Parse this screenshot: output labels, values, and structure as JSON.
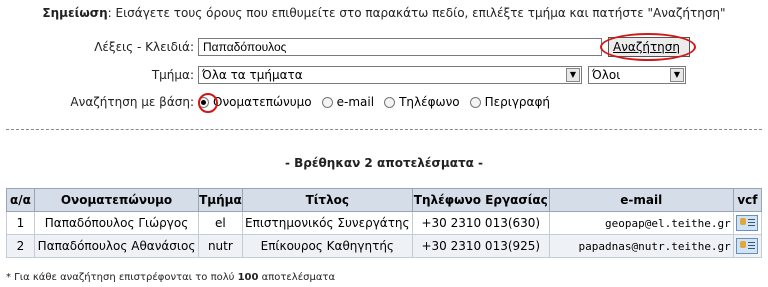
{
  "note": {
    "bold": "Σημείωση",
    "text": ": Εισάγετε τους όρους που επιθυμείτε στο παρακάτω πεδίο, επιλέξτε τμήμα και πατήστε \"Αναζήτηση\""
  },
  "form": {
    "keywords_label": "Λέξεις - Κλειδιά:",
    "keywords_value": "Παπαδόπουλος",
    "search_button": "Αναζήτηση",
    "department_label": "Τμήμα:",
    "department_value": "Όλα τα τμήματα",
    "role_value": "Όλοι",
    "searchby_label": "Αναζήτηση με βάση:",
    "options": [
      "Ονοματεπώνυμο",
      "e-mail",
      "Τηλέφωνο",
      "Περιγραφή"
    ],
    "selected_option": "Ονοματεπώνυμο"
  },
  "results": {
    "summary": "- Βρέθηκαν 2 αποτελέσματα -",
    "headers": [
      "α/α",
      "Ονοματεπώνυμο",
      "Τμήμα",
      "Τίτλος",
      "Τηλέφωνο Εργασίας",
      "e-mail",
      "vcf"
    ],
    "rows": [
      {
        "num": "1",
        "name": "Παπαδόπουλος Γιώργος",
        "dept": "el",
        "title": "Επιστημονικός Συνεργάτης",
        "phone": "+30 2310 013(630)",
        "email": "geopap@el.teithe.gr"
      },
      {
        "num": "2",
        "name": "Παπαδόπουλος Αθανάσιος",
        "dept": "nutr",
        "title": "Επίκουρος Καθηγητής",
        "phone": "+30 2310 013(925)",
        "email": "papadnas@nutr.teithe.gr"
      }
    ]
  },
  "footnote": {
    "prefix": "* Για κάθε αναζήτηση επιστρέφονται το πολύ ",
    "bold": "100",
    "suffix": " αποτελέσματα"
  },
  "colors": {
    "highlight_ring": "#d01818",
    "table_header": "#d5dde8"
  }
}
